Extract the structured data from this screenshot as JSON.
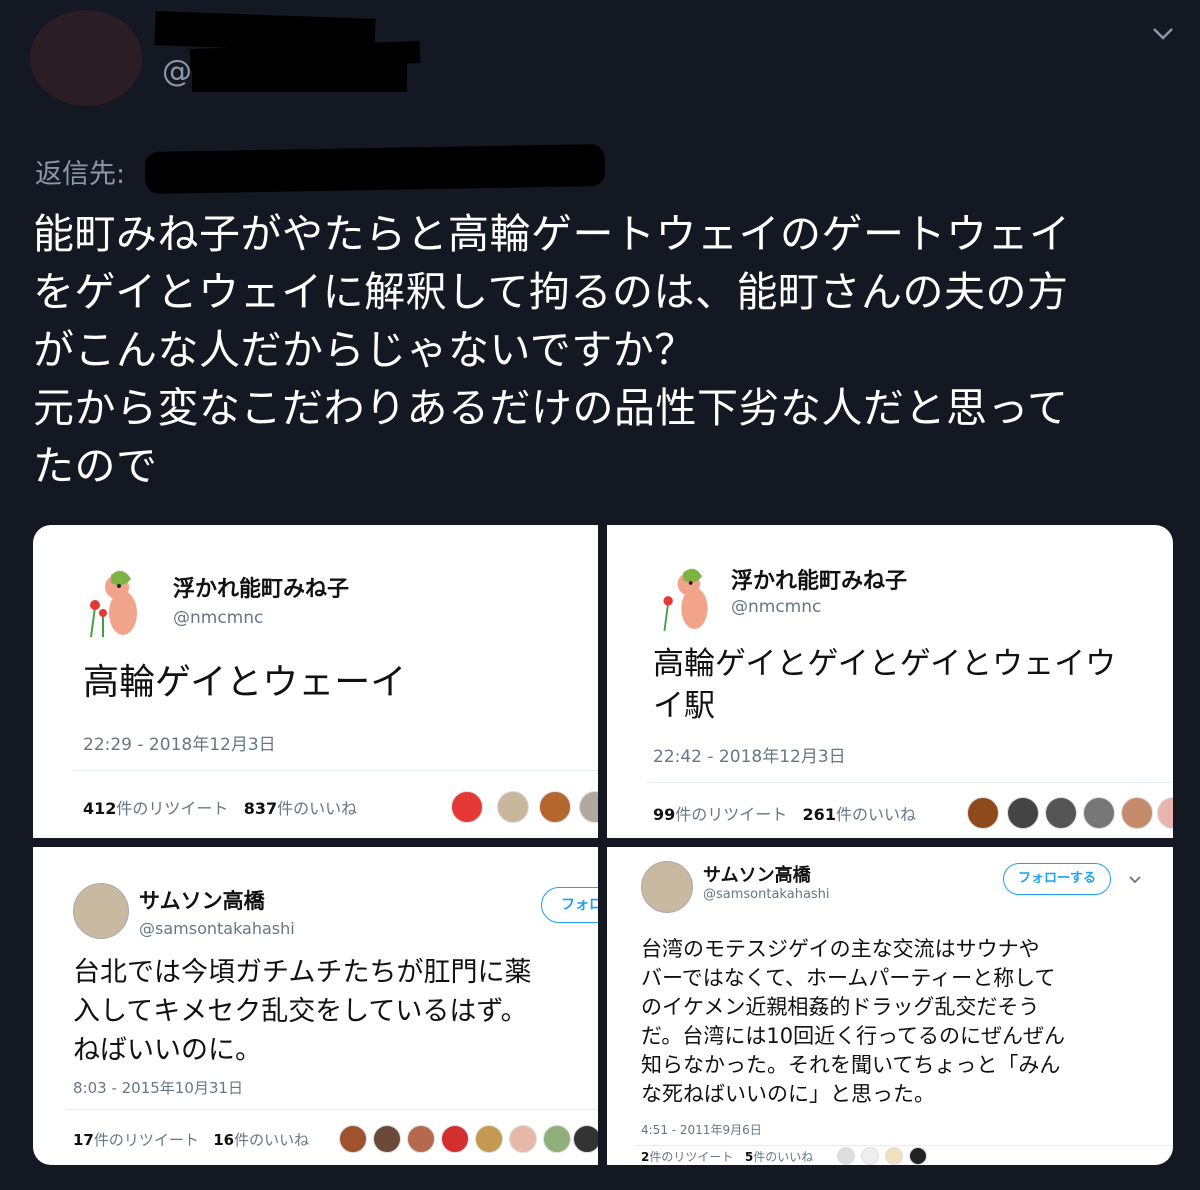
{
  "tweet": {
    "handle_prefix": "@",
    "reply_label": "返信先:",
    "text_lines": [
      "能町みね子がやたらと高輪ゲートウェイのゲートウェイ",
      "をゲイとウェイに解釈して拘るのは、能町さんの夫の方",
      "がこんな人だからじゃないですか？",
      "元から変なこだわりあるだけの品性下劣な人だと思って",
      "たので"
    ]
  },
  "cards": [
    {
      "name": "浮かれ能町みね子",
      "handle": "@nmcmnc",
      "text_lines": [
        "高輪ゲイとウェーイ"
      ],
      "time": "22:29 - 2018年12月3日",
      "retweets_count": "412",
      "retweets_label": "件のリツイート",
      "likes_count": "837",
      "likes_label": "件のいいね"
    },
    {
      "name": "浮かれ能町みね子",
      "handle": "@nmcmnc",
      "text_lines": [
        "高輪ゲイとゲイとゲイとウェイウ",
        "イ駅"
      ],
      "time": "22:42 - 2018年12月3日",
      "retweets_count": "99",
      "retweets_label": "件のリツイート",
      "likes_count": "261",
      "likes_label": "件のいいね"
    },
    {
      "name": "サムソン高橋",
      "handle": "@samsontakahashi",
      "follow_label": "フォロ",
      "text_lines": [
        "台北では今頃ガチムチたちが肛門に薬",
        "入してキメセク乱交をしているはず。",
        "ねばいいのに。"
      ],
      "time": "8:03 - 2015年10月31日",
      "retweets_count": "17",
      "retweets_label": "件のリツイート",
      "likes_count": "16",
      "likes_label": "件のいいね"
    },
    {
      "name": "サムソン高橋",
      "handle": "@samsontakahashi",
      "follow_label": "フォローする",
      "text_lines": [
        "台湾のモテスジゲイの主な交流はサウナや",
        "バーではなくて、ホームパーティーと称して",
        "のイケメン近親相姦的ドラッグ乱交だそう",
        "だ。台湾には10回近く行ってるのにぜんぜん",
        "知らなかった。それを聞いてちょっと「みん",
        "な死ねばいいのに」と思った。"
      ],
      "time": "4:51 - 2011年9月6日",
      "retweets_count": "2",
      "retweets_label": "件のリツイート",
      "likes_count": "5",
      "likes_label": "件のいいね"
    }
  ]
}
